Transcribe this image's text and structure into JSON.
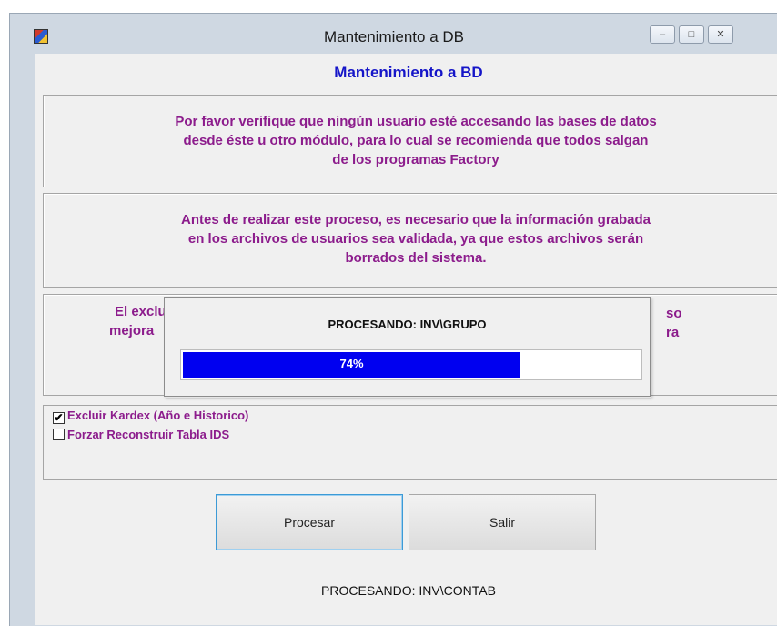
{
  "window": {
    "title": "Mantenimiento a DB",
    "controls": [
      "minimize-icon",
      "maximize-icon",
      "close-icon"
    ]
  },
  "heading": "Mantenimiento a BD",
  "panels": [
    "Por favor verifique que ningún usuario esté accesando las bases de datos\ndesde éste u otro módulo, para lo cual se recomienda que todos salgan\nde los programas Factory",
    "Antes de realizar este proceso, es necesario que la información grabada\nen los archivos de usuarios sea validada, ya que estos archivos serán\nborrados del sistema."
  ],
  "partial_panel": {
    "left_line1": "El exclu",
    "left_line2": "mejora",
    "right_line1": "so",
    "right_line2": "ra"
  },
  "options": [
    {
      "label": "Excluir Kardex (Año e Historico)",
      "checked": true
    },
    {
      "label": "Forzar Reconstruir Tabla IDS",
      "checked": false
    }
  ],
  "buttons": {
    "procesar": "Procesar",
    "salir": "Salir"
  },
  "status": "PROCESANDO: INV\\CONTAB",
  "progress_dialog": {
    "label": "PROCESANDO: INV\\GRUPO",
    "percent_text": "74%",
    "value": 0.74
  },
  "colors": {
    "heading": "#1515c8",
    "panel_text": "#8c1c8c",
    "progress_fill": "#0000f0"
  }
}
